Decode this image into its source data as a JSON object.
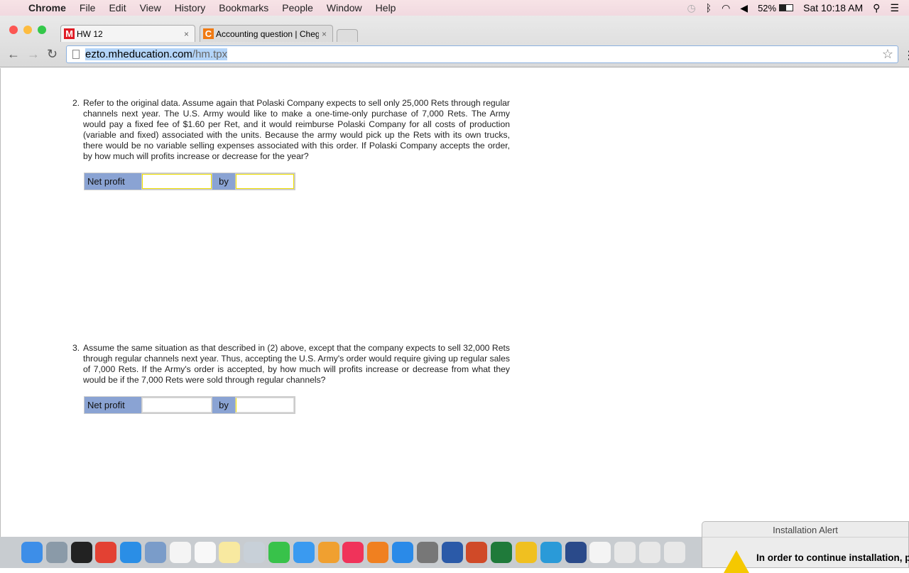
{
  "menubar": {
    "app": "Chrome",
    "items": [
      "File",
      "Edit",
      "View",
      "History",
      "Bookmarks",
      "People",
      "Window",
      "Help"
    ],
    "battery": "52%",
    "clock": "Sat 10:18 AM"
  },
  "tabs": [
    {
      "label": "HW 12",
      "favicon": "M",
      "color": "#e01b24"
    },
    {
      "label": "Accounting question | Cheg",
      "favicon": "C",
      "color": "#f07a12"
    }
  ],
  "address": {
    "host": "ezto.mheducation.com",
    "path": "/hm.tpx"
  },
  "questions": [
    {
      "number": "2.",
      "text": "Refer to the original data. Assume again that Polaski Company expects to sell only 25,000 Rets through regular channels next year. The U.S. Army would like to make a one-time-only purchase of 7,000 Rets. The Army would pay a fixed fee of $1.60 per Ret, and it would reimburse Polaski Company for all costs of production (variable and fixed) associated with the units. Because the army would pick up the Rets with its own trucks, there would be no variable selling expenses associated with this order. If Polaski Company accepts the order, by how much will profits increase or decrease for the year?",
      "label": "Net profit",
      "by": "by",
      "value1": "",
      "value2": ""
    },
    {
      "number": "3.",
      "text": "Assume the same situation as that described in (2) above, except that the company expects to sell 32,000 Rets through regular channels next year. Thus, accepting the U.S. Army's order would require giving up regular sales of 7,000 Rets. If the Army's order is accepted, by how much will profits increase or decrease from what they would be if the 7,000 Rets were sold through regular channels?",
      "label": "Net profit",
      "by": "by",
      "value1": "",
      "value2": ""
    }
  ],
  "alert": {
    "title": "Installation Alert",
    "message": "In order to continue installation, p"
  },
  "dock": [
    {
      "name": "finder",
      "color": "#3d8ee8"
    },
    {
      "name": "launchpad",
      "color": "#8a9aa8"
    },
    {
      "name": "mission-control",
      "color": "#222"
    },
    {
      "name": "chrome",
      "color": "#e34133"
    },
    {
      "name": "safari",
      "color": "#2a8ee6"
    },
    {
      "name": "mail",
      "color": "#7a9cc9"
    },
    {
      "name": "calendar",
      "color": "#f4f4f4"
    },
    {
      "name": "reminders",
      "color": "#f8f8f8"
    },
    {
      "name": "notes",
      "color": "#f8e9a0"
    },
    {
      "name": "preview",
      "color": "#c8d0d8"
    },
    {
      "name": "facetime",
      "color": "#38c24a"
    },
    {
      "name": "messages",
      "color": "#3a9af0"
    },
    {
      "name": "photos",
      "color": "#f0a030"
    },
    {
      "name": "itunes",
      "color": "#f0335a"
    },
    {
      "name": "ibooks",
      "color": "#f08020"
    },
    {
      "name": "app-store",
      "color": "#2a8ae8"
    },
    {
      "name": "system-preferences",
      "color": "#777"
    },
    {
      "name": "word",
      "color": "#2b5aa8"
    },
    {
      "name": "powerpoint",
      "color": "#d04a28"
    },
    {
      "name": "excel",
      "color": "#1f7a3a"
    },
    {
      "name": "o-app",
      "color": "#f0c020"
    },
    {
      "name": "c-app",
      "color": "#2a9ad8"
    },
    {
      "name": "quicktime",
      "color": "#2a4a8a"
    },
    {
      "name": "document",
      "color": "#f4f4f4"
    },
    {
      "name": "word-doc-1",
      "color": "#e8e8e8"
    },
    {
      "name": "word-doc-2",
      "color": "#e8e8e8"
    },
    {
      "name": "word-doc-3",
      "color": "#e8e8e8"
    }
  ]
}
